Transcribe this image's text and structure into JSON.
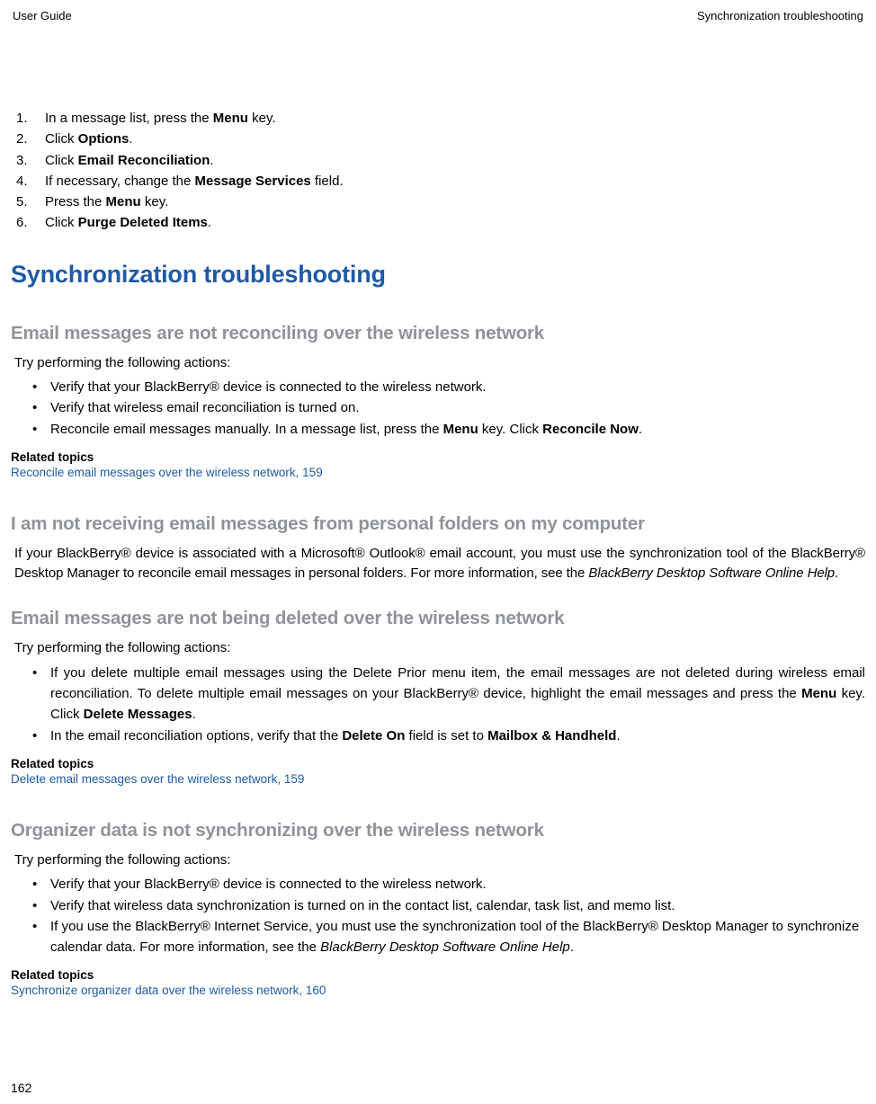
{
  "header": {
    "left": "User Guide",
    "right": "Synchronization troubleshooting"
  },
  "steps": [
    {
      "n": "1.",
      "pre": "In a message list, press the ",
      "bold": "Menu",
      "post": " key."
    },
    {
      "n": "2.",
      "pre": "Click ",
      "bold": "Options",
      "post": "."
    },
    {
      "n": "3.",
      "pre": "Click ",
      "bold": "Email Reconciliation",
      "post": "."
    },
    {
      "n": "4.",
      "pre": "If necessary, change the ",
      "bold": "Message Services",
      "post": " field."
    },
    {
      "n": "5.",
      "pre": "Press the ",
      "bold": "Menu",
      "post": " key."
    },
    {
      "n": "6.",
      "pre": "Click ",
      "bold": "Purge Deleted Items",
      "post": "."
    }
  ],
  "h1": "Synchronization troubleshooting",
  "sec1": {
    "title": "Email messages are not reconciling over the wireless network",
    "intro": "Try performing the following actions:",
    "b1": "Verify that your BlackBerry® device is connected to the wireless network.",
    "b2": "Verify that wireless email reconciliation is turned on.",
    "b3_pre": "Reconcile email messages manually. In a message list, press the ",
    "b3_bold1": "Menu",
    "b3_mid": " key. Click ",
    "b3_bold2": "Reconcile Now",
    "b3_post": ".",
    "related_label": "Related topics",
    "related_link": "Reconcile email messages over the wireless network, 159"
  },
  "sec2": {
    "title": "I am not receiving email messages from personal folders on my computer",
    "p_pre": "If your BlackBerry® device is associated with a Microsoft® Outlook® email account, you must use the synchronization tool of the BlackBerry® Desktop Manager to reconcile email messages in personal folders. For more information, see the  ",
    "p_italic": "BlackBerry Desktop Software Online Help",
    "p_post": "."
  },
  "sec3": {
    "title": "Email messages are not being deleted over the wireless network",
    "intro": "Try performing the following actions:",
    "b1_pre": "If you delete multiple email messages using the Delete Prior menu item, the email messages are not deleted during wireless email reconciliation. To delete multiple email messages on your BlackBerry® device, highlight the email messages and press the ",
    "b1_bold1": "Menu",
    "b1_mid": " key. Click ",
    "b1_bold2": "Delete Messages",
    "b1_post": ".",
    "b2_pre": "In the email reconciliation options, verify that the ",
    "b2_bold1": "Delete On",
    "b2_mid": " field is set to ",
    "b2_bold2": "Mailbox & Handheld",
    "b2_post": ".",
    "related_label": "Related topics",
    "related_link": "Delete email messages over the wireless network, 159"
  },
  "sec4": {
    "title": "Organizer data is not synchronizing over the wireless network",
    "intro": "Try performing the following actions:",
    "b1": "Verify that your BlackBerry® device is connected to the wireless network.",
    "b2": "Verify that wireless data synchronization is turned on in the contact list, calendar, task list, and memo list.",
    "b3_pre": "If you use the BlackBerry® Internet Service, you must use the synchronization tool of the BlackBerry® Desktop Manager to synchronize calendar data. For more information, see the  ",
    "b3_italic": "BlackBerry Desktop Software Online Help",
    "b3_post": ".",
    "related_label": "Related topics",
    "related_link": "Synchronize organizer data over the wireless network, 160"
  },
  "pagenum": "162"
}
